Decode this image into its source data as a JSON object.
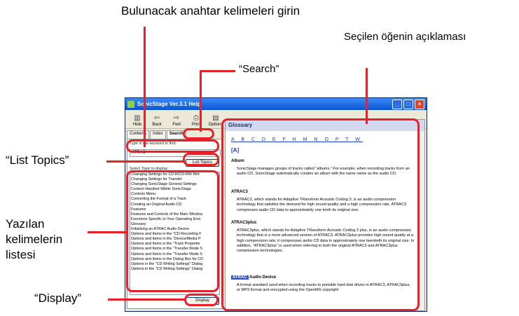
{
  "callouts": {
    "keyword": "Bulunacak anahtar kelimeleri girin",
    "description": "Seçilen öğenin açıklaması",
    "search": "“Search”",
    "list_topics": "“List Topics”",
    "topics_list_line1": "Yazılan",
    "topics_list_line2": "kelimelerin",
    "topics_list_line3": "listesi",
    "display": "“Display”"
  },
  "window": {
    "title": "SonicStage Ver.3.1 Help",
    "toolbar": [
      {
        "label": "Hide",
        "icon": "hide-icon"
      },
      {
        "label": "Back",
        "icon": "back-icon"
      },
      {
        "label": "Fwd",
        "icon": "forward-icon"
      },
      {
        "label": "Print",
        "icon": "print-icon"
      },
      {
        "label": "Options",
        "icon": "options-icon"
      }
    ],
    "tabs": [
      "Contents",
      "Index",
      "Search"
    ],
    "keyword_label": "Type in the keyword to find:",
    "keyword_value": "ATRAC",
    "list_topics_button": "List Topics",
    "select_topic_label": "Select Topic to display:",
    "topics": [
      "Changing Settings for CD-R/CD-RW Writ",
      "Changing Settings for Transfer",
      "Changing SonicStage General Settings",
      "Content Handled Within SonicStage",
      "Controls Menu",
      "Converting the Format of a Track",
      "Creating an Original Audio CD",
      "Features",
      "Features and Controls of the Main Window",
      "Functions Specific to Your Operating Envi",
      "Glossary",
      "Initializing an ATRAC Audio Device",
      "Options and Items in the \"CD Recording F",
      "Options and Items in the \"Device/Media P",
      "Options and Items in the \"Track Propertie",
      "Options and Items in the \"Transfer Mode S",
      "Options and Items in the \"Transfer Mode S",
      "Options and Items in the Dialog Box for CD",
      "Options in the \"CD Writing Settings\" Dialog",
      "Options in the \"CD Writing Settings\" Dialog"
    ],
    "display_button": "Display",
    "glossary": {
      "header": "Glossary",
      "letters": "A B C D E F H M N O P T W",
      "anchor": "[A]",
      "entries": [
        {
          "term": "Album",
          "text": "SonicStage manages groups of tracks called \"albums.\" For example, when recording tracks from an audio CD, SonicStage automatically creates an album with the same name as the audio CD."
        },
        {
          "term": "ATRAC3",
          "text": "ATRAC3, which stands for Adaptive TRansform Acoustic Coding 3, is an audio compression technology that satisfies the demand for high sound quality and a high compression rate. ATRAC3 compresses audio CD data to approximately one tenth its original size."
        },
        {
          "term": "ATRAC3plus",
          "text": "ATRAC3plus, which stands for Adaptive TRansform Acoustic Coding 3 plus, is an audio compression technology that is a more advanced version of ATRAC3. ATRAC3plus provides high sound quality at a high compression rate; it compresses audio CD data to approximately one twentieth its original size. In addition, \"ATRAC3plus\" is used when referring to both the original ATRAC3 and ATRAC3plus compression technologies."
        },
        {
          "term_hl": "ATRAC",
          "term": "Audio Device",
          "text": "A format standard used when recording tracks to portable hard disk drives in ATRAC3, ATRAC3plus, or MP3 format and encrypted using the OpenMG copyright"
        }
      ]
    }
  }
}
